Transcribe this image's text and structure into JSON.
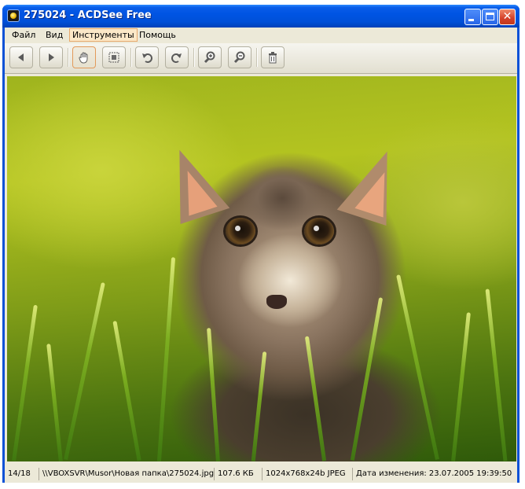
{
  "window": {
    "title": "275024 - ACDSee Free",
    "close_glyph": "✕"
  },
  "menu": {
    "items": [
      "Файл",
      "Вид",
      "Инструменты",
      "Помощь"
    ],
    "active": "Инструменты"
  },
  "toolbar": {
    "buttons": [
      {
        "icon": "arrow-left-icon"
      },
      {
        "icon": "arrow-right-icon"
      },
      {
        "icon": "hand-pan-icon",
        "pressed": true
      },
      {
        "icon": "fit-screen-icon"
      },
      {
        "icon": "rotate-left-icon"
      },
      {
        "icon": "rotate-right-icon"
      },
      {
        "icon": "zoom-in-icon"
      },
      {
        "icon": "zoom-out-icon"
      },
      {
        "icon": "trash-icon"
      }
    ]
  },
  "image": {
    "subject": "photo-kitten-in-grass"
  },
  "status": {
    "position": "14/18",
    "path": "\\\\VBOXSVR\\Musor\\Новая папка\\275024.jpg",
    "size": "107.6 КБ",
    "dimensions": "1024x768x24b JPEG",
    "modified": "Дата изменения: 23.07.2005 19:39:50"
  },
  "colors": {
    "titlebar": "#0054e3",
    "chrome": "#ece9d8",
    "active_menu_border": "#e7a86c",
    "close_button": "#d4402a"
  }
}
